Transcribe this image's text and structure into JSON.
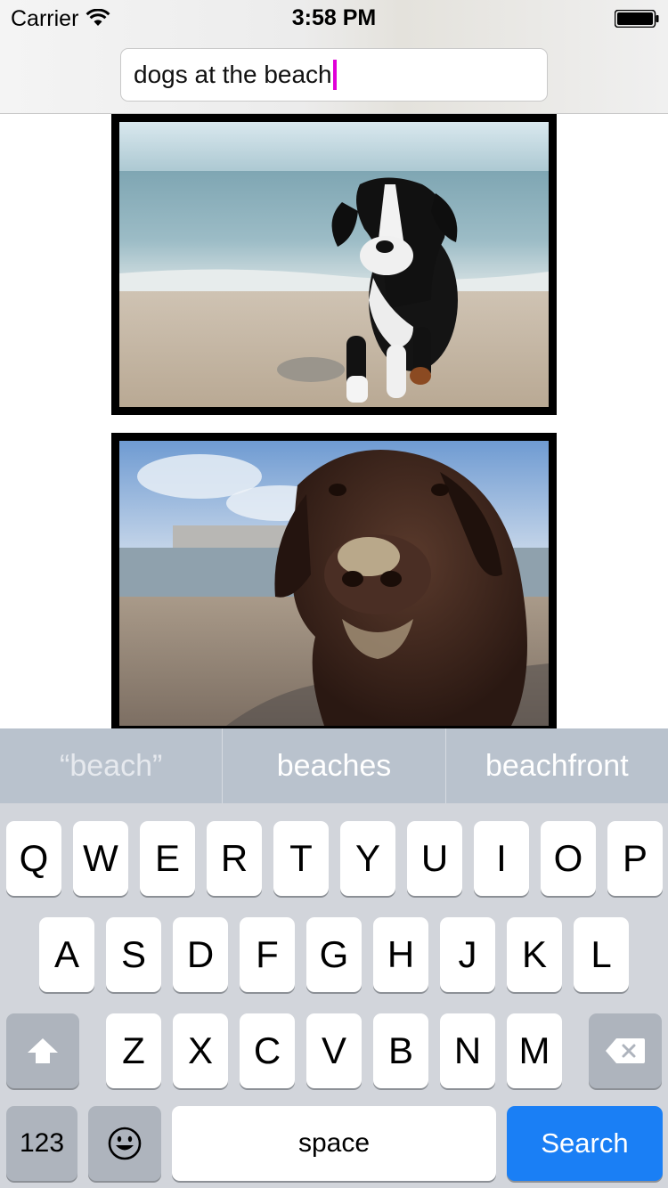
{
  "status_bar": {
    "carrier": "Carrier",
    "time": "3:58 PM",
    "wifi_icon": "wifi-icon",
    "battery_icon": "battery-icon"
  },
  "search": {
    "value": "dogs at the beach"
  },
  "photos": [
    {
      "subject": "black and white puppy walking on beach"
    },
    {
      "subject": "brown dog with sandy nose on beach"
    }
  ],
  "suggestions": [
    "“beach”",
    "beaches",
    "beachfront"
  ],
  "keyboard": {
    "row1": [
      "Q",
      "W",
      "E",
      "R",
      "T",
      "Y",
      "U",
      "I",
      "O",
      "P"
    ],
    "row2": [
      "A",
      "S",
      "D",
      "F",
      "G",
      "H",
      "J",
      "K",
      "L"
    ],
    "row3": [
      "Z",
      "X",
      "C",
      "V",
      "B",
      "N",
      "M"
    ],
    "shift_icon": "shift-arrow-icon",
    "delete_icon": "delete-backspace-icon",
    "emoji_icon": "emoji-face-icon",
    "numbers_label": "123",
    "space_label": "space",
    "search_label": "Search",
    "search_key_color": "#1a7ff5"
  }
}
